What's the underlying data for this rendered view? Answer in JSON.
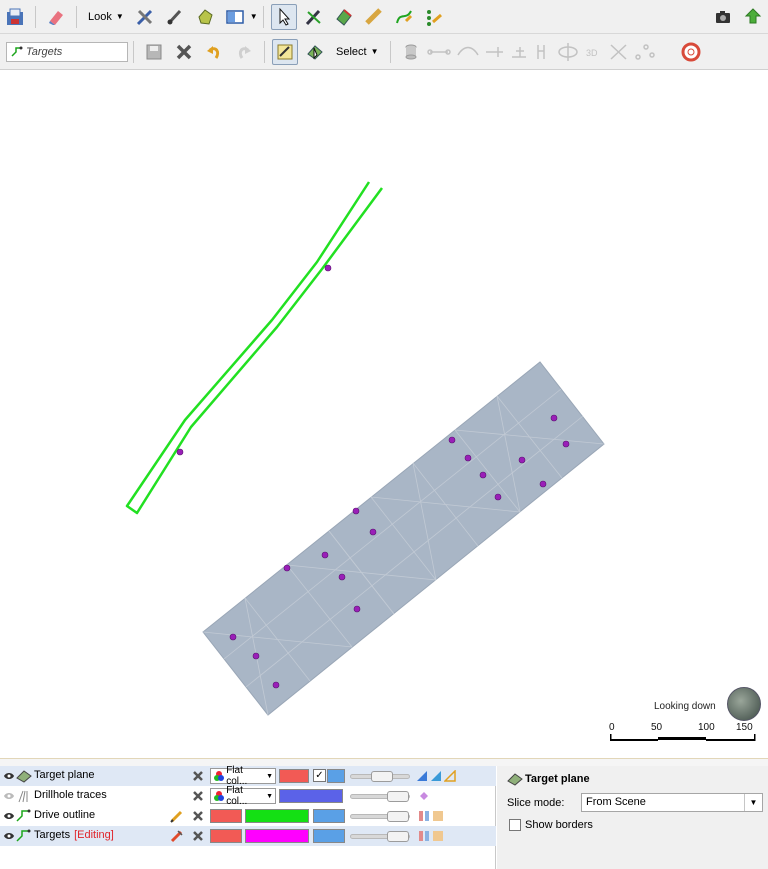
{
  "toolbar": {
    "look_label": "Look",
    "select_label": "Select",
    "targets_field": "Targets"
  },
  "viewport": {
    "looking_label": "Looking down",
    "scale_labels": [
      "0",
      "50",
      "100",
      "150"
    ]
  },
  "layers": [
    {
      "name": "Target plane",
      "editing": "",
      "mode": "Flat col...",
      "color": "#f25a55",
      "checkbox": true,
      "second_color": "#5aa0e6"
    },
    {
      "name": "Drillhole traces",
      "editing": "",
      "mode": "Flat col...",
      "color": "#5b62e8"
    },
    {
      "name": "Drive outline",
      "editing": "",
      "color": "#f25a55",
      "second_color": "#14e014",
      "third_color": "#5aa0e6"
    },
    {
      "name": "Targets",
      "editing": "[Editing]",
      "color": "#f25a55",
      "second_color": "#ff00ff",
      "third_color": "#5aa0e6"
    }
  ],
  "properties": {
    "title": "Target plane",
    "slice_mode_label": "Slice mode:",
    "slice_mode_value": "From Scene",
    "show_borders_label": "Show borders",
    "show_borders_checked": false
  },
  "colors": {
    "drive_outline": "#22e022",
    "target_plane_fill": "#a9b6c6",
    "target_point": "#9a1fb8"
  },
  "icons": {
    "tb1": [
      "save-view-icon",
      "eraser-icon",
      "tools-icon",
      "brush-icon",
      "polygon-icon",
      "layout-icon",
      "pointer-icon",
      "pencil-icon",
      "surface-icon",
      "ruler-icon",
      "polyline-icon",
      "points-icon",
      "camera-icon",
      "export-icon"
    ],
    "tb2": [
      "save-icon",
      "discard-icon",
      "undo-icon",
      "redo-icon",
      "edit-mode-icon",
      "select-mode-icon",
      "cylinder-icon"
    ]
  }
}
